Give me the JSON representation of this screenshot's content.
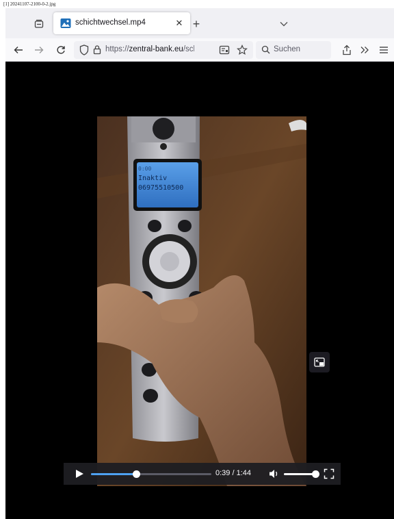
{
  "caption": "[1] 20241107-2100-0-2.jpg",
  "tab": {
    "title": "schichtwechsel.mp4",
    "close_glyph": "✕",
    "new_tab_glyph": "+"
  },
  "urlbar": {
    "scheme": "https://",
    "domain": "zentral-bank.eu",
    "path": "/schi"
  },
  "search": {
    "placeholder": "Suchen"
  },
  "video": {
    "current_time": "0:39",
    "duration": "1:44",
    "time_label": "0:39 / 1:44",
    "progress": 0.375,
    "volume": 1.0
  },
  "phone_screen": {
    "line1": "0:00",
    "line2": "Inaktiv",
    "line3": "06975510500"
  },
  "colors": {
    "accent": "#4ea1f1",
    "frame_bg": "#f0f0f4",
    "content_bg": "#000000"
  },
  "icons": {
    "list_tabs": "tab-list-icon",
    "favicon": "video-file-icon",
    "dropdown": "chevron-down-icon",
    "back": "back-arrow-icon",
    "forward": "forward-arrow-icon",
    "reload": "reload-icon",
    "tracking": "shield-icon",
    "lock": "lock-icon",
    "reader": "reader-view-icon",
    "bookmark": "star-icon",
    "search": "search-icon",
    "share": "share-icon",
    "overflow": "double-chevron-icon",
    "menu": "hamburger-menu-icon",
    "pip": "picture-in-picture-icon",
    "play": "play-icon",
    "mute": "speaker-icon",
    "fullscreen": "fullscreen-icon"
  }
}
